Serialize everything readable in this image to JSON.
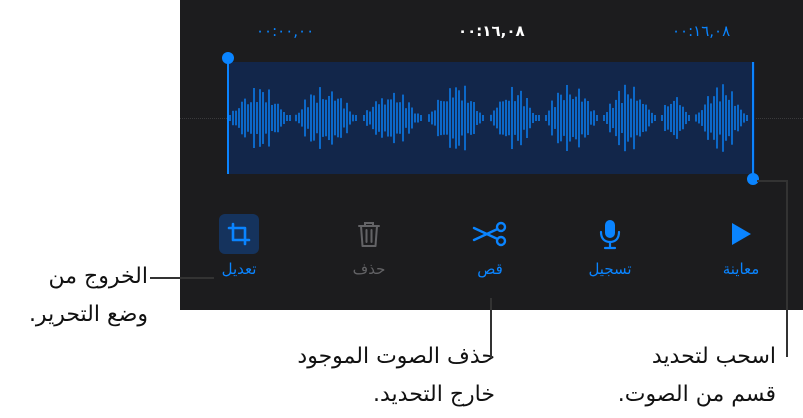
{
  "timeline": {
    "start_time": "٠٠:٠٠,٠٠",
    "current_time": "٠٠:١٦,٠٨",
    "end_time": "٠٠:١٦,٠٨"
  },
  "toolbar": {
    "edit_label": "تعديل",
    "delete_label": "حذف",
    "trim_label": "قص",
    "record_label": "تسجيل",
    "preview_label": "معاينة"
  },
  "icons": {
    "edit": "crop-icon",
    "delete": "trash-icon",
    "trim": "scissors-icon",
    "record": "microphone-icon",
    "preview": "play-icon"
  },
  "callouts": {
    "exit_edit_line1": "الخروج من",
    "exit_edit_line2": "وضع التحرير.",
    "trim_line1": "حذف الصوت الموجود",
    "trim_line2": "خارج التحديد.",
    "drag_line1": "اسحب لتحديد",
    "drag_line2": "قسم من الصوت."
  },
  "colors": {
    "accent": "#0a84ff",
    "panel_background": "#1c1c1e",
    "selection_background": "#12264a",
    "disabled": "#636366"
  }
}
